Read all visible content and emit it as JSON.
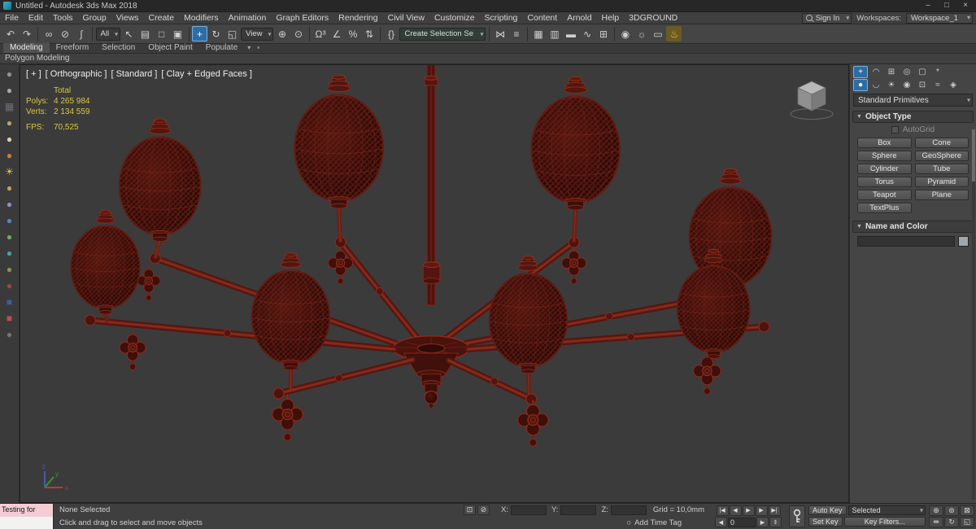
{
  "titlebar": {
    "title": "Untitled - Autodesk 3ds Max 2018",
    "minimize": "–",
    "maximize": "□",
    "close": "×"
  },
  "menubar": {
    "items": [
      "File",
      "Edit",
      "Tools",
      "Group",
      "Views",
      "Create",
      "Modifiers",
      "Animation",
      "Graph Editors",
      "Rendering",
      "Civil View",
      "Customize",
      "Scripting",
      "Content",
      "Arnold",
      "Help",
      "3DGROUND"
    ],
    "signin_label": "Sign In",
    "workspaces_label": "Workspaces:",
    "workspace_value": "Workspace_1"
  },
  "toolbar": {
    "icons": [
      {
        "n": "undo-icon",
        "g": "↶"
      },
      {
        "n": "redo-icon",
        "g": "↷"
      },
      {
        "n": "separator",
        "cls": "tb-sep",
        "inter": false
      },
      {
        "n": "select-and-link-icon",
        "g": "∞"
      },
      {
        "n": "unlink-selection-icon",
        "g": "⊘"
      },
      {
        "n": "bind-to-space-warp-icon",
        "g": "∫"
      },
      {
        "n": "separator",
        "cls": "tb-sep",
        "inter": false
      },
      {
        "n": "selection-filter-dropdown",
        "g": "All",
        "cls": "tb-dd"
      },
      {
        "n": "select-object-icon",
        "g": "↖"
      },
      {
        "n": "select-by-name-icon",
        "g": "▤"
      },
      {
        "n": "rectangular-selection-region-icon",
        "g": "□"
      },
      {
        "n": "window-crossing-toggle-icon",
        "g": "▣"
      },
      {
        "n": "separator",
        "cls": "tb-sep",
        "inter": false
      },
      {
        "n": "select-and-move-icon",
        "g": "+",
        "cls": "active"
      },
      {
        "n": "select-and-rotate-icon",
        "g": "↻"
      },
      {
        "n": "select-and-scale-icon",
        "g": "◱"
      },
      {
        "n": "reference-coordinate-dropdown",
        "g": "View",
        "cls": "tb-dd"
      },
      {
        "n": "use-pivot-center-icon",
        "g": "⊕"
      },
      {
        "n": "select-and-manipulate-icon",
        "g": "⊙"
      },
      {
        "n": "separator",
        "cls": "tb-sep",
        "inter": false
      },
      {
        "n": "snap-toggle-3d-icon",
        "g": "Ω³"
      },
      {
        "n": "angle-snap-toggle-icon",
        "g": "∠"
      },
      {
        "n": "percent-snap-toggle-icon",
        "g": "%"
      },
      {
        "n": "spinner-snap-toggle-icon",
        "g": "⇅"
      },
      {
        "n": "separator",
        "cls": "tb-sep",
        "inter": false
      },
      {
        "n": "edit-named-selection-sets-icon",
        "g": "{}"
      },
      {
        "n": "named-selection-sets-dropdown",
        "g": "Create Selection Se",
        "cls": "tb-dd sel-set"
      },
      {
        "n": "separator",
        "cls": "tb-sep",
        "inter": false
      },
      {
        "n": "mirror-icon",
        "g": "⋈"
      },
      {
        "n": "align-icon",
        "g": "≡"
      },
      {
        "n": "separator",
        "cls": "tb-sep",
        "inter": false
      },
      {
        "n": "toggle-scene-explorer-icon",
        "g": "▦"
      },
      {
        "n": "toggle-layer-explorer-icon",
        "g": "▥"
      },
      {
        "n": "toggle-ribbon-icon",
        "g": "▬"
      },
      {
        "n": "curve-editor-icon",
        "g": "∿"
      },
      {
        "n": "schematic-view-icon",
        "g": "⊞"
      },
      {
        "n": "separator",
        "cls": "tb-sep",
        "inter": false
      },
      {
        "n": "material-editor-icon",
        "g": "◉"
      },
      {
        "n": "render-setup-icon",
        "g": "☼"
      },
      {
        "n": "rendered-frame-window-icon",
        "g": "▭"
      },
      {
        "n": "render-production-icon",
        "g": "♨",
        "cls": "amber"
      }
    ]
  },
  "ribbon": {
    "tabs": [
      {
        "n": "tab-modeling",
        "g": "Modeling",
        "cls": "active"
      },
      {
        "n": "tab-freeform",
        "g": "Freeform"
      },
      {
        "n": "tab-selection",
        "g": "Selection"
      },
      {
        "n": "tab-object-paint",
        "g": "Object Paint"
      },
      {
        "n": "tab-populate",
        "g": "Populate"
      },
      {
        "n": "ribbon-config-icon",
        "g": "▾",
        "cls": "rt-icon"
      },
      {
        "n": "ribbon-minimize-icon",
        "g": "▪",
        "cls": "rt-icon"
      }
    ],
    "panel_label": "Polygon Modeling"
  },
  "left_strip": {
    "icons": [
      {
        "n": "sphere-gray-icon",
        "g": "●",
        "c": "#8d939b"
      },
      {
        "n": "sphere-silver-icon",
        "g": "●",
        "c": "#a8a8a8"
      },
      {
        "n": "box-dark-icon",
        "g": "▦",
        "c": "#6b6f75"
      },
      {
        "n": "sphere-wood-icon",
        "g": "●",
        "c": "#c2a06b"
      },
      {
        "n": "sphere-cream-icon",
        "g": "●",
        "c": "#ddd0a8"
      },
      {
        "n": "sphere-orange-icon",
        "g": "●",
        "c": "#cd7e35"
      },
      {
        "n": "sun-yellow-icon",
        "g": "☀",
        "c": "#e3c33f"
      },
      {
        "n": "sphere-gold-icon",
        "g": "●",
        "c": "#c8a43c"
      },
      {
        "n": "sphere-violet-icon",
        "g": "●",
        "c": "#9d89c6"
      },
      {
        "n": "sphere-blue-icon",
        "g": "●",
        "c": "#5187c3"
      },
      {
        "n": "sphere-green-icon",
        "g": "●",
        "c": "#6fae57"
      },
      {
        "n": "sphere-teal-icon",
        "g": "●",
        "c": "#49a0a0"
      },
      {
        "n": "sphere-olive-icon",
        "g": "●",
        "c": "#8f9347"
      },
      {
        "n": "sphere-red-icon",
        "g": "●",
        "c": "#a34640"
      },
      {
        "n": "flag-blue-icon",
        "g": "■",
        "c": "#3c5f99"
      },
      {
        "n": "flag-red-icon",
        "g": "■",
        "c": "#bf4d4d"
      },
      {
        "n": "sphere-dim-icon",
        "g": "●",
        "c": "#747474"
      }
    ]
  },
  "viewport": {
    "label": {
      "general": "[ + ]",
      "pov": "[ Orthographic ]",
      "render_preset": "[ Standard ]",
      "shading": "[ Clay + Edged Faces ]"
    },
    "stats": {
      "total_label": "Total",
      "polys_label": "Polys:",
      "polys_value": "4 265 984",
      "verts_label": "Verts:",
      "verts_value": "2 134 559",
      "fps_label": "FPS:",
      "fps_value": "70,525"
    },
    "axis": {
      "x": "x",
      "y": "y",
      "z": "z"
    }
  },
  "command_panel": {
    "tabs": [
      {
        "n": "create-tab-icon",
        "g": "+",
        "cls": "active"
      },
      {
        "n": "modify-tab-icon",
        "g": "◠"
      },
      {
        "n": "hierarchy-tab-icon",
        "g": "⊞"
      },
      {
        "n": "motion-tab-icon",
        "g": "◎"
      },
      {
        "n": "display-tab-icon",
        "g": "▢"
      },
      {
        "n": "utilities-tab-icon",
        "g": "*"
      }
    ],
    "categories": [
      {
        "n": "geometry-category-icon",
        "g": "●",
        "cls": "active"
      },
      {
        "n": "shapes-category-icon",
        "g": "◡"
      },
      {
        "n": "lights-category-icon",
        "g": "☀"
      },
      {
        "n": "cameras-category-icon",
        "g": "◉"
      },
      {
        "n": "helpers-category-icon",
        "g": "⊡"
      },
      {
        "n": "space-warps-category-icon",
        "g": "≈"
      },
      {
        "n": "systems-category-icon",
        "g": "◈"
      }
    ],
    "subcategory_dropdown": "Standard Primitives",
    "rollout_arrow": "▼",
    "object_type_label": "Object Type",
    "autogrid_label": "AutoGrid",
    "object_buttons": [
      "Box",
      "Cone",
      "Sphere",
      "GeoSphere",
      "Cylinder",
      "Tube",
      "Torus",
      "Pyramid",
      "Teapot",
      "Plane",
      "TextPlus"
    ],
    "name_color_label": "Name and Color",
    "swatch_color": "#a2a6ad"
  },
  "statusbar": {
    "listener_text": "Testing for",
    "status": "None Selected",
    "prompt": "Click and drag to select and move objects",
    "mid_icons": [
      {
        "n": "isolate-selection-toggle-icon",
        "g": "⊡"
      },
      {
        "n": "selection-lock-toggle-icon",
        "g": "⊘"
      }
    ],
    "x_label": "X:",
    "y_label": "Y:",
    "z_label": "Z:",
    "grid_label": "Grid = 10,0mm",
    "time_tag_icon": "○",
    "time_tag_label": "Add Time Tag",
    "playback": [
      {
        "n": "go-to-start-icon",
        "g": "|◀"
      },
      {
        "n": "previous-frame-icon",
        "g": "◀"
      },
      {
        "n": "play-animation-icon",
        "g": "▶"
      },
      {
        "n": "next-frame-icon",
        "g": "▶"
      },
      {
        "n": "go-to-end-icon",
        "g": "▶|"
      }
    ],
    "frame_back_icon": "◀",
    "frame_fwd_icon": "▶",
    "frame_spin_icon": "⇕",
    "frame_value": "0",
    "auto_key_label": "Auto Key",
    "set_key_label": "Set Key",
    "selected_dropdown": "Selected",
    "key_filters_label": "Key Filters...",
    "nav": [
      {
        "n": "zoom-icon",
        "g": "⊕"
      },
      {
        "n": "zoom-all-icon",
        "g": "⊚"
      },
      {
        "n": "zoom-extents-icon",
        "g": "⊠"
      },
      {
        "n": "pan-icon",
        "g": "⇹"
      },
      {
        "n": "orbit-icon",
        "g": "↻"
      },
      {
        "n": "maximize-viewport-toggle-icon",
        "g": "◱"
      }
    ]
  }
}
